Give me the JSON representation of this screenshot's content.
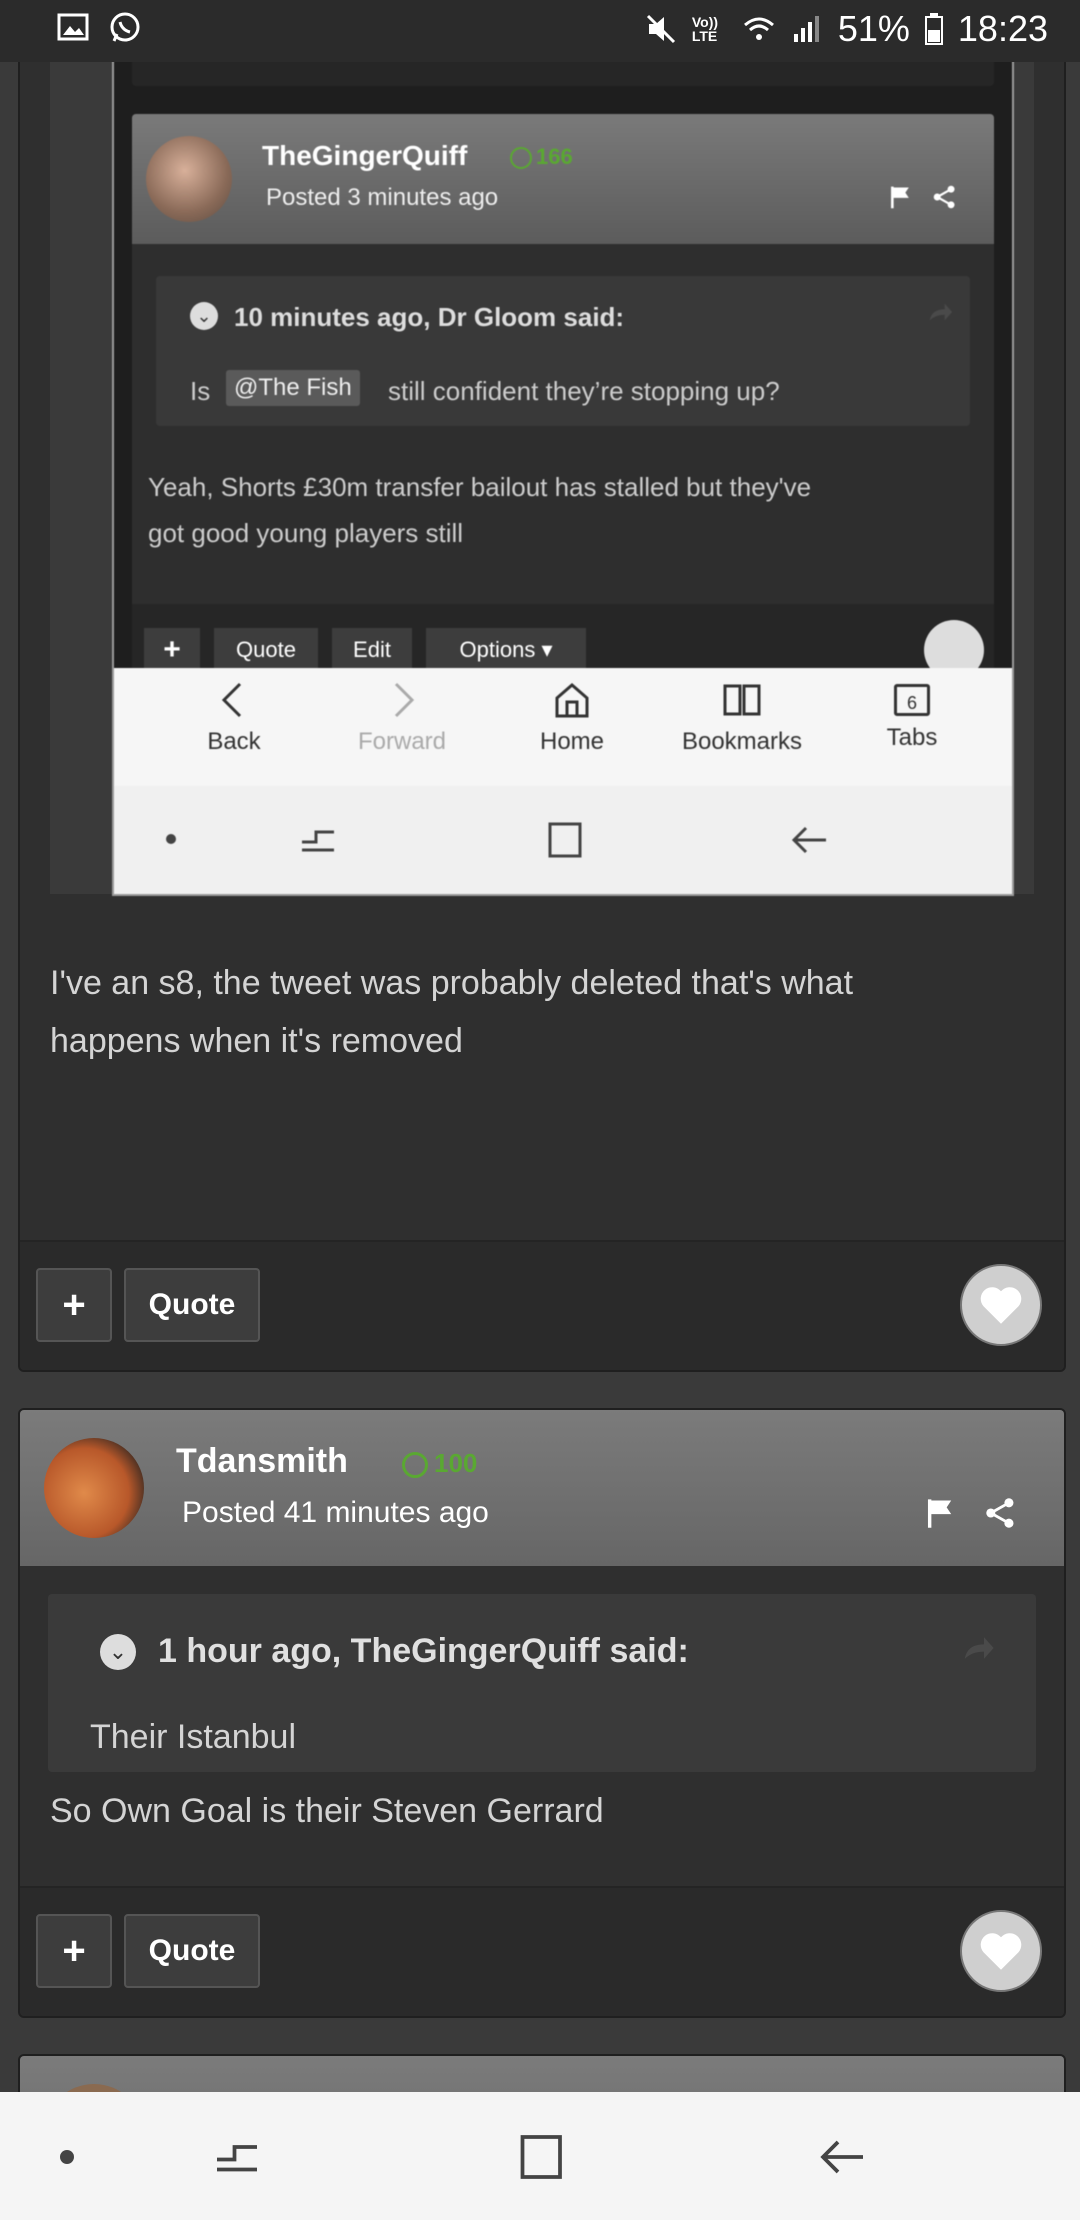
{
  "status_bar": {
    "battery": "51%",
    "time": "18:23",
    "volte": "Vo)) LTE"
  },
  "embedded_screenshot": {
    "post": {
      "username": "TheGingerQuiff",
      "reputation": "166",
      "posted": "Posted 3 minutes ago",
      "quote_header": "10 minutes ago, Dr Gloom said:",
      "quote_prefix": "Is",
      "mention": "@The Fish",
      "quote_suffix": "still confident they’re stopping up?",
      "body_line1": "Yeah, Shorts £30m transfer bailout has stalled but they've",
      "body_line2": "got good young players still",
      "btn_plus": "+",
      "btn_quote": "Quote",
      "btn_edit": "Edit",
      "btn_options": "Options"
    },
    "browser_nav": {
      "back": "Back",
      "forward": "Forward",
      "home": "Home",
      "bookmarks": "Bookmarks",
      "tabs": "Tabs",
      "tab_count": "6"
    }
  },
  "post1": {
    "text_line1": "I've an s8, the tweet was probably deleted that's what",
    "text_line2": "happens when it's removed",
    "btn_plus": "+",
    "btn_quote": "Quote"
  },
  "post2": {
    "username": "Tdansmith",
    "reputation": "100",
    "posted": "Posted 41 minutes ago",
    "quote_header": "1 hour ago, TheGingerQuiff said:",
    "quote_text": "Their Istanbul",
    "body": "So Own Goal is their Steven Gerrard",
    "btn_plus": "+",
    "btn_quote": "Quote"
  },
  "colors": {
    "reputation_green": "#5aa832",
    "background": "#3a3a3a"
  }
}
